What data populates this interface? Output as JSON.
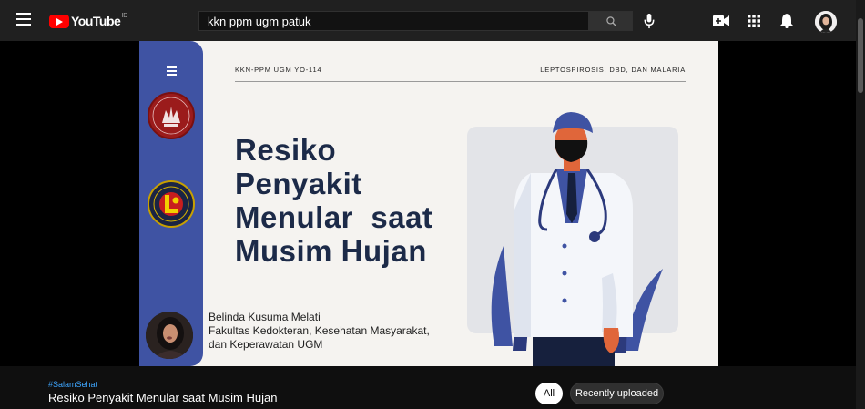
{
  "header": {
    "logo_text": "YouTube",
    "country_code": "ID",
    "search_query": "kkn ppm ugm patuk",
    "icons": [
      "menu-icon",
      "search-icon",
      "mic-icon",
      "create-video-icon",
      "apps-icon",
      "notifications-icon",
      "avatar"
    ]
  },
  "slide": {
    "header_left": "KKN-PPM UGM YO-114",
    "header_right": "LEPTOSPIROSIS, DBD, DAN MALARIA",
    "title_lines": [
      "Resiko",
      "Penyakit",
      "Menular  saat",
      "Musim Hujan"
    ],
    "author_lines": [
      "Belinda Kusuma Melati",
      "Fakultas Kedokteran, Kesehatan Masyarakat,",
      "dan Keperawatan UGM"
    ],
    "colors": {
      "panel": "#3f53a3",
      "title": "#1c2a48",
      "background": "#f5f3f0"
    }
  },
  "video_info": {
    "hashtag": "#SalamSehat",
    "title": "Resiko Penyakit Menular saat Musim Hujan"
  },
  "chips": {
    "all": "All",
    "recent": "Recently uploaded"
  }
}
